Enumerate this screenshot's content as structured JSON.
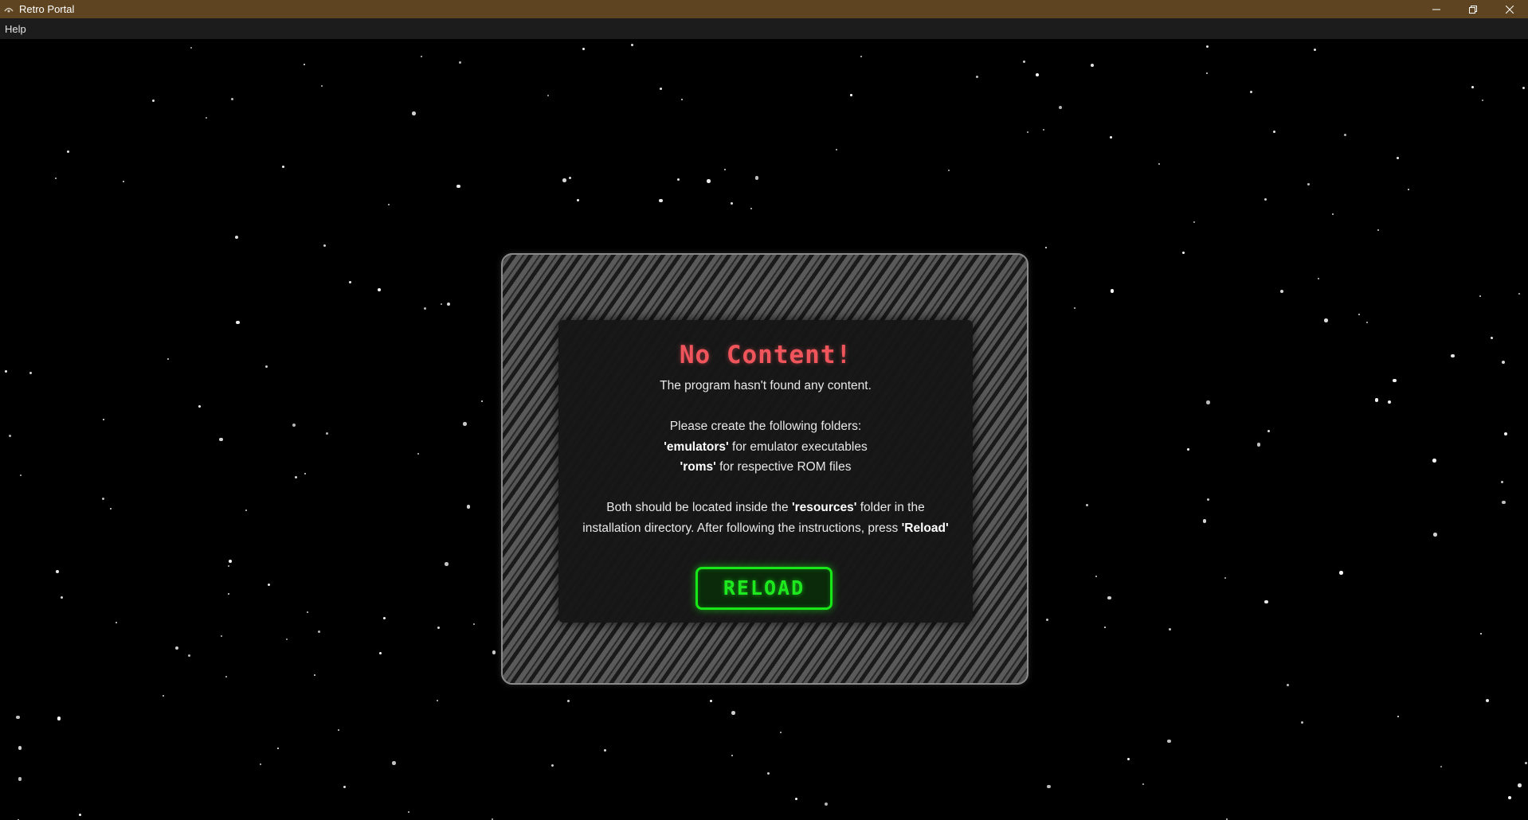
{
  "window": {
    "title": "Retro Portal",
    "controls": [
      "minimize-icon",
      "restore-icon",
      "close-icon"
    ]
  },
  "menubar": {
    "items": [
      {
        "label": "Help"
      }
    ]
  },
  "dialog": {
    "title": "No Content!",
    "line1": "The program hasn't found any content.",
    "line2": "Please create the following folders:",
    "folder1_name": "'emulators'",
    "folder1_desc": " for emulator executables",
    "folder2_name": "'roms'",
    "folder2_desc": " for respective ROM files",
    "line3_pre": "Both should be located inside the ",
    "line3_bold": "'resources'",
    "line3_post": " folder in the",
    "line4_pre": "installation directory. After following the instructions, press ",
    "line4_bold": "'Reload'",
    "reload_label": "RELOAD"
  },
  "colors": {
    "titlebar": "#5e4420",
    "menubar": "#1c1c1c",
    "background": "#000000",
    "title_red": "#f0555c",
    "button_green": "#19e619"
  }
}
